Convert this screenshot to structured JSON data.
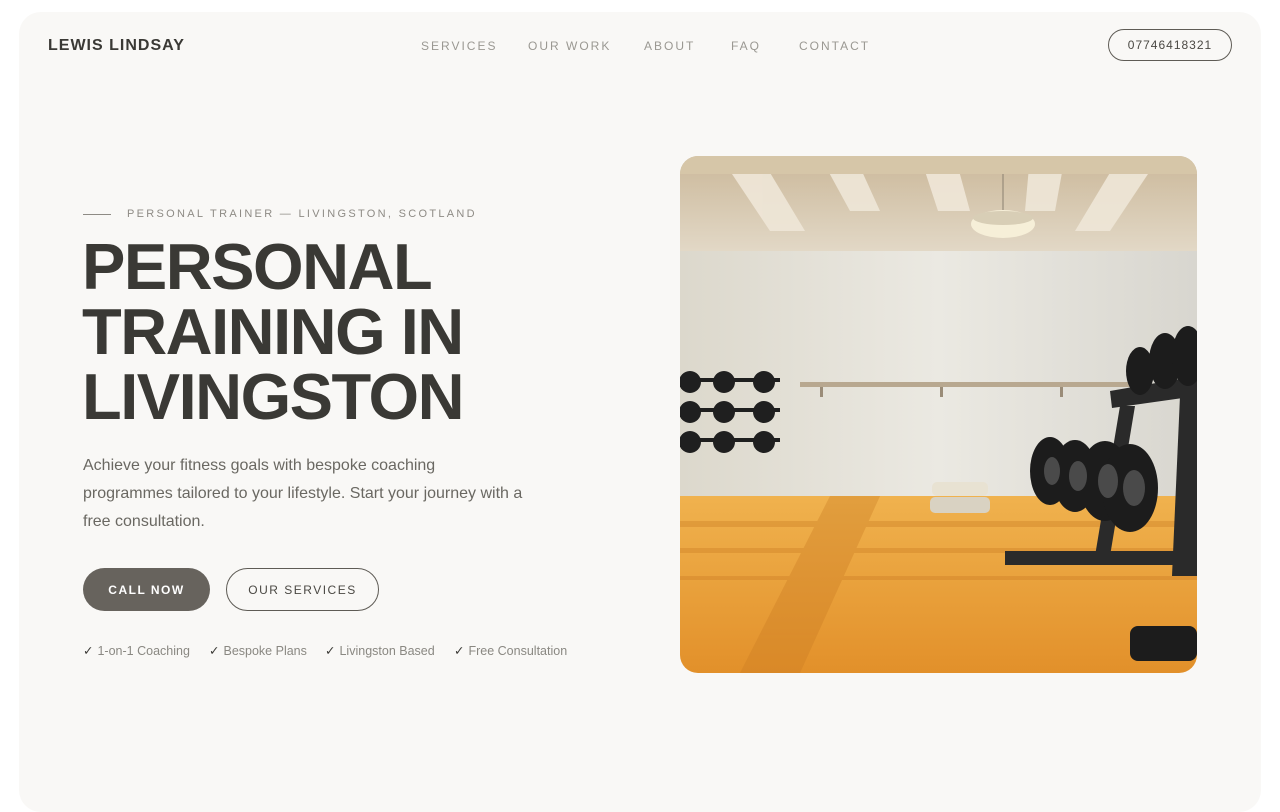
{
  "brand": "LEWIS LINDSAY",
  "nav": {
    "links": [
      "SERVICES",
      "OUR WORK",
      "ABOUT",
      "FAQ",
      "CONTACT"
    ],
    "phone": "07746418321"
  },
  "hero": {
    "eyebrow": "PERSONAL TRAINER — LIVINGSTON, SCOTLAND",
    "headline": [
      "PERSONAL",
      "TRAINING IN",
      "LIVINGSTON"
    ],
    "lede": "Achieve your fitness goals with bespoke coaching programmes tailored to your lifestyle. Start your journey with a free consultation.",
    "primary_cta": "CALL NOW",
    "secondary_cta": "OUR SERVICES",
    "features": [
      {
        "check": "✓",
        "label": "1-on-1 Coaching"
      },
      {
        "check": "✓",
        "label": "Bespoke Plans"
      },
      {
        "check": "✓",
        "label": "Livingston Based"
      },
      {
        "check": "✓",
        "label": "Free Consultation"
      }
    ]
  },
  "colors": {
    "page_bg": "#f9f8f6",
    "text_dark": "#3a3935",
    "text_muted": "#9a9892",
    "button_primary": "#67635d",
    "floor_orange": "#eea33c",
    "wall": "#e6e4dc"
  }
}
